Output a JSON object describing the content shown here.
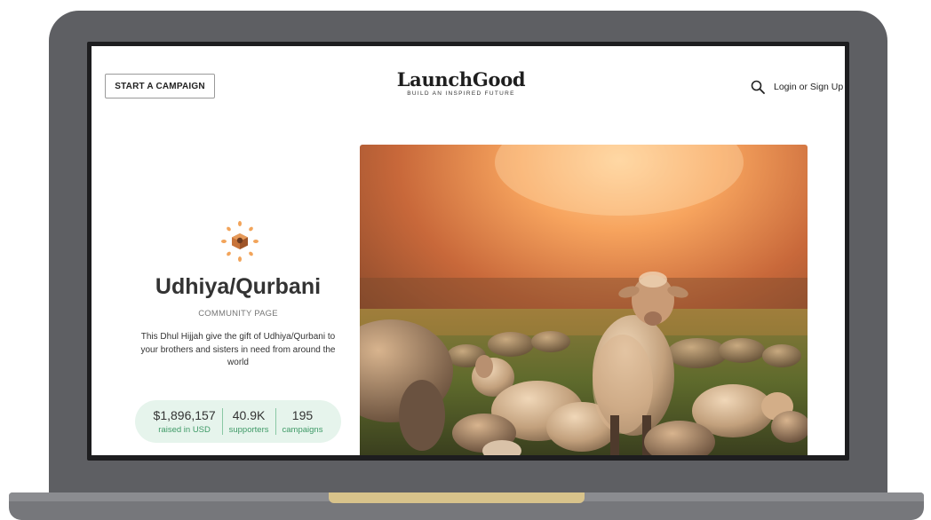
{
  "header": {
    "start_campaign_label": "START A CAMPAIGN",
    "logo_name": "LaunchGood",
    "logo_tagline": "BUILD AN INSPIRED FUTURE",
    "login_label": "Login or Sign Up"
  },
  "community": {
    "title": "Udhiya/Qurbani",
    "subtitle": "COMMUNITY PAGE",
    "description": "This Dhul Hijjah give the gift of Udhiya/Qurbani to your brothers and sisters in need from around the world"
  },
  "stats": [
    {
      "value": "$1,896,157",
      "label": "raised in USD"
    },
    {
      "value": "40.9K",
      "label": "supporters"
    },
    {
      "value": "195",
      "label": "campaigns"
    }
  ],
  "icons": {
    "search": "search-icon",
    "emblem": "sunburst-emblem-icon"
  },
  "colors": {
    "accent_green": "#3f9a67",
    "stats_background": "#e6f4ec",
    "emblem_orange": "#f2a45a",
    "laptop_frame": "#5e5f63"
  }
}
